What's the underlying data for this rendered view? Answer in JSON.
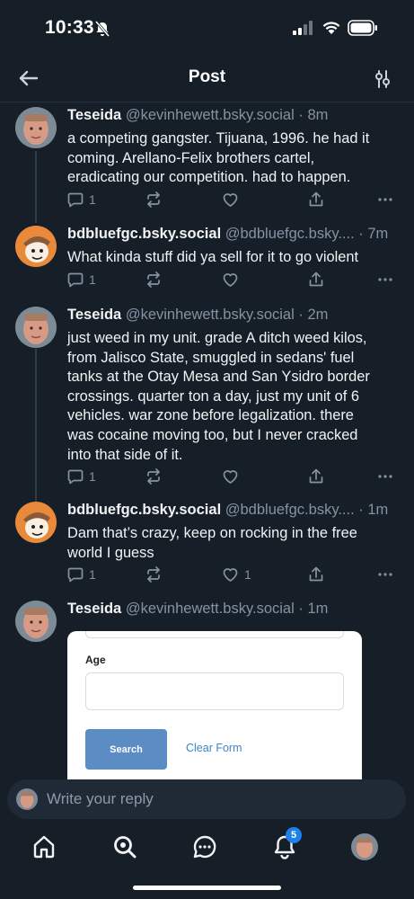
{
  "status": {
    "time": "10:33"
  },
  "header": {
    "title": "Post"
  },
  "posts": [
    {
      "name": "Teseida",
      "handle": "@kevinhewett.bsky.social",
      "time": "· 8m",
      "lines": [
        "a competing gangster. Tijuana, 1996. he had it",
        "coming. Arellano-Felix brothers cartel,",
        "eradicating our competition. had to happen."
      ],
      "replies": "1",
      "likes": ""
    },
    {
      "name": "bdbluefgc.bsky.social",
      "handle": "@bdbluefgc.bsky....",
      "time": "· 7m",
      "lines": [
        "What kinda stuff did ya sell for it to go violent"
      ],
      "replies": "1",
      "likes": ""
    },
    {
      "name": "Teseida",
      "handle": "@kevinhewett.bsky.social",
      "time": "· 2m",
      "lines": [
        "just weed in my unit. grade A ditch weed kilos,",
        "from Jalisco State, smuggled in sedans' fuel",
        "tanks at the Otay Mesa and San Ysidro border",
        "crossings. quarter ton a day, just my unit of 6",
        "vehicles. war zone before legalization. there",
        "was cocaine moving too, but I never cracked",
        "into that side of it."
      ],
      "replies": "1",
      "likes": ""
    },
    {
      "name": "bdbluefgc.bsky.social",
      "handle": "@bdbluefgc.bsky....",
      "time": "· 1m",
      "lines": [
        "Dam that’s crazy, keep on rocking in the free",
        "world I guess"
      ],
      "replies": "1",
      "likes": "1"
    },
    {
      "name": "Teseida",
      "handle": "@kevinhewett.bsky.social",
      "time": "· 1m"
    }
  ],
  "embed": {
    "label": "Age",
    "search_label": "Search",
    "clear_label": "Clear Form"
  },
  "reply": {
    "placeholder": "Write your reply"
  },
  "tabs": {
    "notifications_badge": "5"
  },
  "icons": {
    "back": "arrow-left-icon",
    "settings": "sliders-icon",
    "reply": "speech-bubble-icon",
    "repost": "repost-icon",
    "like": "heart-icon",
    "share": "share-icon",
    "more": "ellipsis-icon",
    "home": "home-icon",
    "search": "search-icon",
    "chat": "chat-icon",
    "bell": "bell-icon"
  },
  "colors": {
    "background": "#161e27",
    "text": "#f1f3f5",
    "muted": "#8493a3",
    "accent": "#1f80e9"
  }
}
